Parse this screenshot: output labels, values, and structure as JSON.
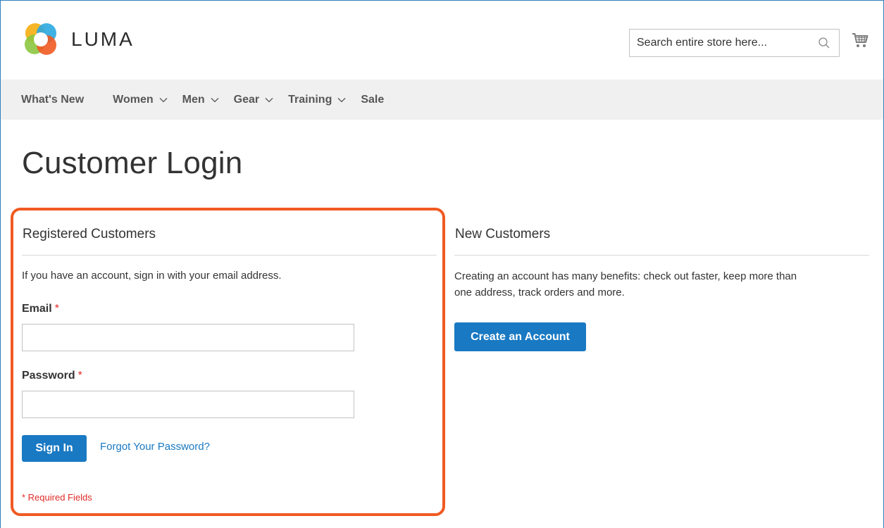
{
  "brand": {
    "name": "LUMA"
  },
  "search": {
    "placeholder": "Search entire store here..."
  },
  "nav": {
    "items": [
      {
        "label": "What's New",
        "has_dropdown": false
      },
      {
        "label": "Women",
        "has_dropdown": true
      },
      {
        "label": "Men",
        "has_dropdown": true
      },
      {
        "label": "Gear",
        "has_dropdown": true
      },
      {
        "label": "Training",
        "has_dropdown": true
      },
      {
        "label": "Sale",
        "has_dropdown": false
      }
    ]
  },
  "page": {
    "title": "Customer Login"
  },
  "registered": {
    "title": "Registered Customers",
    "intro": "If you have an account, sign in with your email address.",
    "email_label": "Email",
    "password_label": "Password",
    "required_mark": "*",
    "email_value": "",
    "password_value": "",
    "sign_in_label": "Sign In",
    "forgot_label": "Forgot Your Password?",
    "required_note": "* Required Fields"
  },
  "new_customers": {
    "title": "New Customers",
    "text_line1": "Creating an account has many benefits: check out faster, keep more than",
    "text_line2": "one address, track orders and more.",
    "create_label": "Create an Account"
  },
  "colors": {
    "accent": "#1979c3",
    "highlight_border": "#f05a22",
    "required": "#e02b27",
    "nav_bg": "#f0f0f0"
  },
  "icons": {
    "search": "search-icon",
    "cart": "cart-icon",
    "dropdown": "chevron-down-icon",
    "logo": "luma-logo-icon"
  }
}
